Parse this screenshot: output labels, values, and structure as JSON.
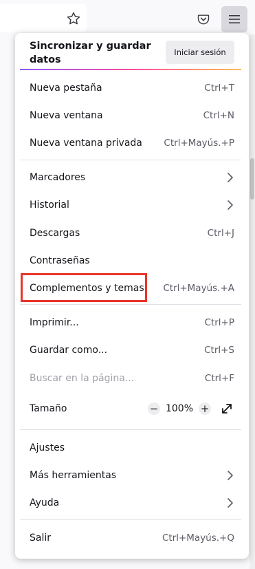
{
  "toolbar": {
    "star_icon": "bookmark-star-icon",
    "pocket_icon": "pocket-icon",
    "menu_icon": "hamburger-menu-icon"
  },
  "menu": {
    "sync_title": "Sincronizar y guardar datos",
    "signin_label": "Iniciar sesión",
    "items": [
      {
        "label": "Nueva pestaña",
        "shortcut": "Ctrl+T"
      },
      {
        "label": "Nueva ventana",
        "shortcut": "Ctrl+N"
      },
      {
        "label": "Nueva ventana privada",
        "shortcut": "Ctrl+Mayús.+P"
      },
      {
        "label": "Marcadores",
        "shortcut": ""
      },
      {
        "label": "Historial",
        "shortcut": ""
      },
      {
        "label": "Descargas",
        "shortcut": "Ctrl+J"
      },
      {
        "label": "Contraseñas",
        "shortcut": ""
      },
      {
        "label": "Complementos y temas",
        "shortcut": "Ctrl+Mayús.+A"
      },
      {
        "label": "Imprimir...",
        "shortcut": "Ctrl+P"
      },
      {
        "label": "Guardar como...",
        "shortcut": "Ctrl+S"
      },
      {
        "label": "Buscar en la página...",
        "shortcut": "Ctrl+F"
      },
      {
        "label": "Tamaño",
        "shortcut": ""
      },
      {
        "label": "Ajustes",
        "shortcut": ""
      },
      {
        "label": "Más herramientas",
        "shortcut": ""
      },
      {
        "label": "Ayuda",
        "shortcut": ""
      },
      {
        "label": "Salir",
        "shortcut": "Ctrl+Mayús.+Q"
      }
    ],
    "zoom": {
      "minus": "−",
      "value": "100%",
      "plus": "+"
    }
  },
  "colors": {
    "highlight": "#e8352b",
    "menu_button_bg": "#d8d8de"
  }
}
